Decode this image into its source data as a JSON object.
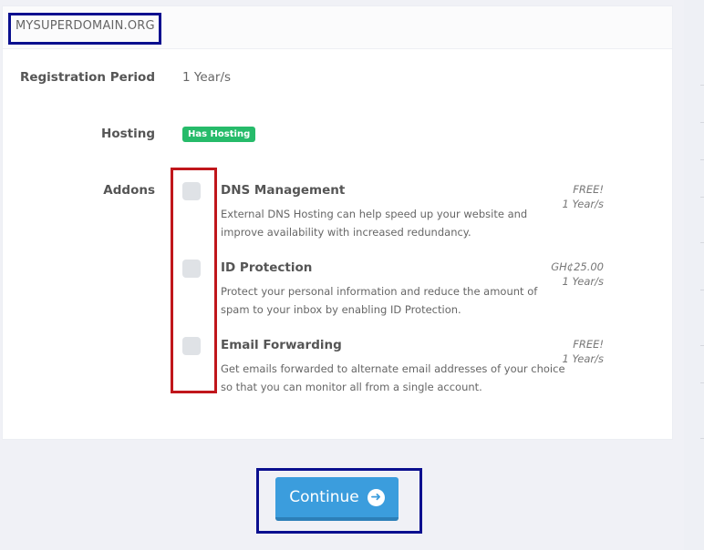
{
  "domain": "MYSUPERDOMAIN.ORG",
  "fields": {
    "registration_period_label": "Registration Period",
    "registration_period_value": "1 Year/s",
    "hosting_label": "Hosting",
    "hosting_badge": "Has Hosting",
    "addons_label": "Addons"
  },
  "addons": [
    {
      "title": "DNS Management",
      "description": "External DNS Hosting can help speed up your website and improve availability with increased redundancy.",
      "price": "FREE!",
      "term": "1 Year/s",
      "checked": false
    },
    {
      "title": "ID Protection",
      "description": "Protect your personal information and reduce the amount of spam to your inbox by enabling ID Protection.",
      "price": "GH¢25.00",
      "term": "1 Year/s",
      "checked": false
    },
    {
      "title": "Email Forwarding",
      "description": "Get emails forwarded to alternate email addresses of your choice so that you can monitor all from a single account.",
      "price": "FREE!",
      "term": "1 Year/s",
      "checked": false
    }
  ],
  "continue_button": {
    "label": "Continue",
    "icon": "arrow-circle-right-icon"
  },
  "colors": {
    "badge_green": "#26bb6a",
    "button_blue": "#3b9ddd",
    "highlight_blue": "#0a0f8f",
    "highlight_red": "#c0161b"
  }
}
